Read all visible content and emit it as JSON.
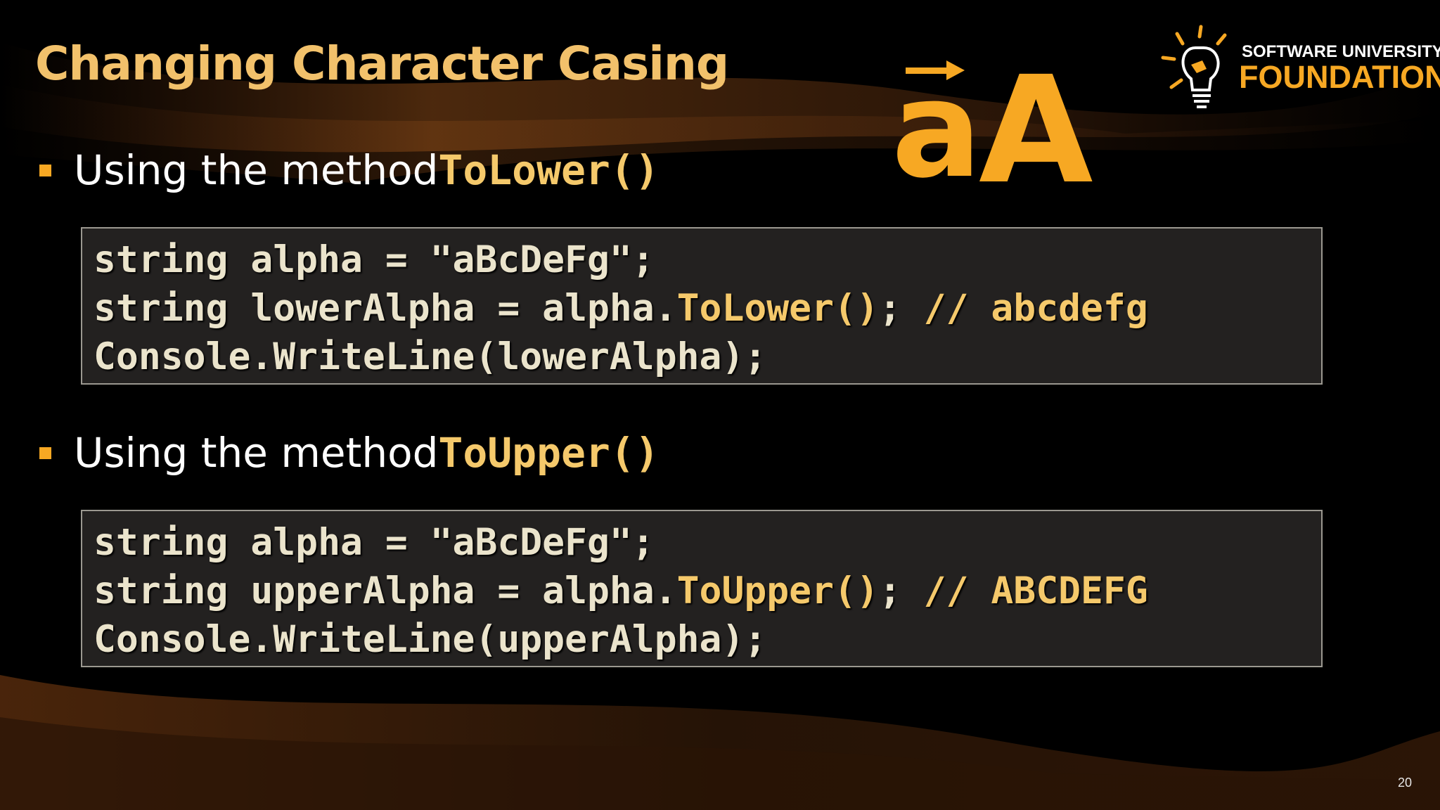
{
  "slide": {
    "title": "Changing Character Casing",
    "page_number": "20"
  },
  "logo": {
    "line1": "SOFTWARE UNIVERSITY",
    "line2": "FOUNDATION"
  },
  "icon": {
    "name": "aa-casing-icon",
    "lower_letter": "a",
    "upper_letter": "A",
    "color": "#f7a823"
  },
  "bullets": [
    {
      "text": "Using the method ",
      "code": "ToLower()",
      "code_lines": [
        {
          "parts": [
            {
              "t": "string alpha = \"aBcDeFg\";",
              "hl": false
            }
          ]
        },
        {
          "parts": [
            {
              "t": "string lowerAlpha = alpha.",
              "hl": false
            },
            {
              "t": "ToLower()",
              "hl": true
            },
            {
              "t": "; ",
              "hl": false
            },
            {
              "t": "// abcdefg",
              "hl": true
            }
          ]
        },
        {
          "parts": [
            {
              "t": "Console.WriteLine(lowerAlpha);",
              "hl": false
            }
          ]
        }
      ]
    },
    {
      "text": "Using the method ",
      "code": "ToUpper()",
      "code_lines": [
        {
          "parts": [
            {
              "t": "string alpha = \"aBcDeFg\";",
              "hl": false
            }
          ]
        },
        {
          "parts": [
            {
              "t": "string upperAlpha = alpha.",
              "hl": false
            },
            {
              "t": "ToUpper()",
              "hl": true
            },
            {
              "t": "; ",
              "hl": false
            },
            {
              "t": "// ABCDEFG",
              "hl": true
            }
          ]
        },
        {
          "parts": [
            {
              "t": "Console.WriteLine(upperAlpha);",
              "hl": false
            }
          ]
        }
      ]
    }
  ],
  "colors": {
    "accent": "#f7a823",
    "title": "#f2c16b",
    "code_highlight": "#f5c96b",
    "code_text": "#ebe4cc",
    "code_bg": "#232120"
  }
}
